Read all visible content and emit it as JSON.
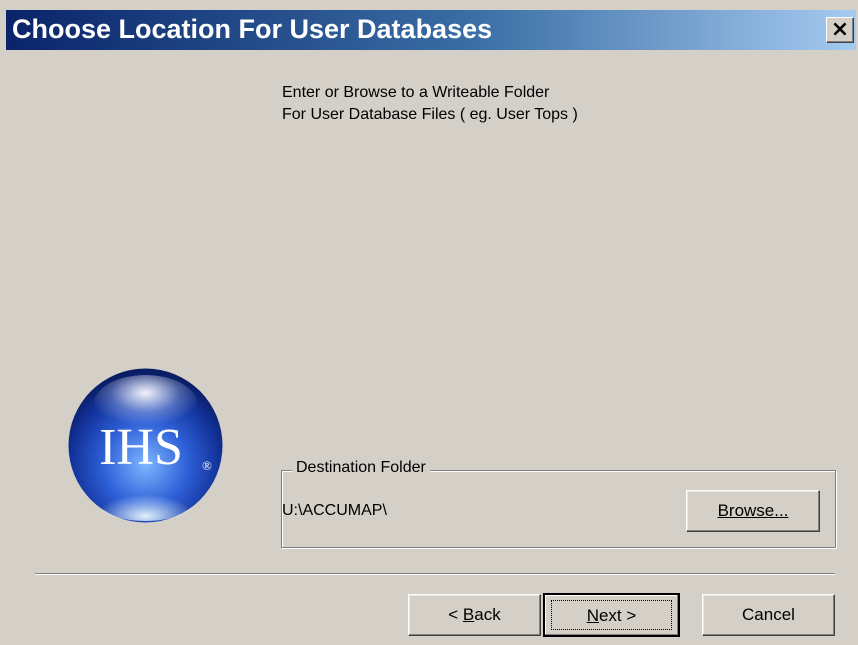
{
  "window": {
    "title": "Choose Location For User Databases",
    "close_label": "×"
  },
  "instructions": {
    "line1": "Enter or Browse to a Writeable Folder",
    "line2": "For User Database Files ( eg. User Tops )"
  },
  "logo": {
    "text": "IHS",
    "mark": "®",
    "icon": "ihs-globe-logo",
    "colors": {
      "sphere": "#1a3fa8",
      "highlight": "#ffffff"
    }
  },
  "destination": {
    "group_label": "Destination Folder",
    "path": "U:\\ACCUMAP\\",
    "browse_label": "Browse..."
  },
  "buttons": {
    "back_prefix": "< ",
    "back_mnemonic": "B",
    "back_rest": "ack",
    "next_mnemonic": "N",
    "next_rest": "ext >",
    "cancel": "Cancel"
  },
  "colors": {
    "face": "#d4d0c8",
    "title_start": "#0a246a",
    "title_end": "#a6caf0"
  }
}
